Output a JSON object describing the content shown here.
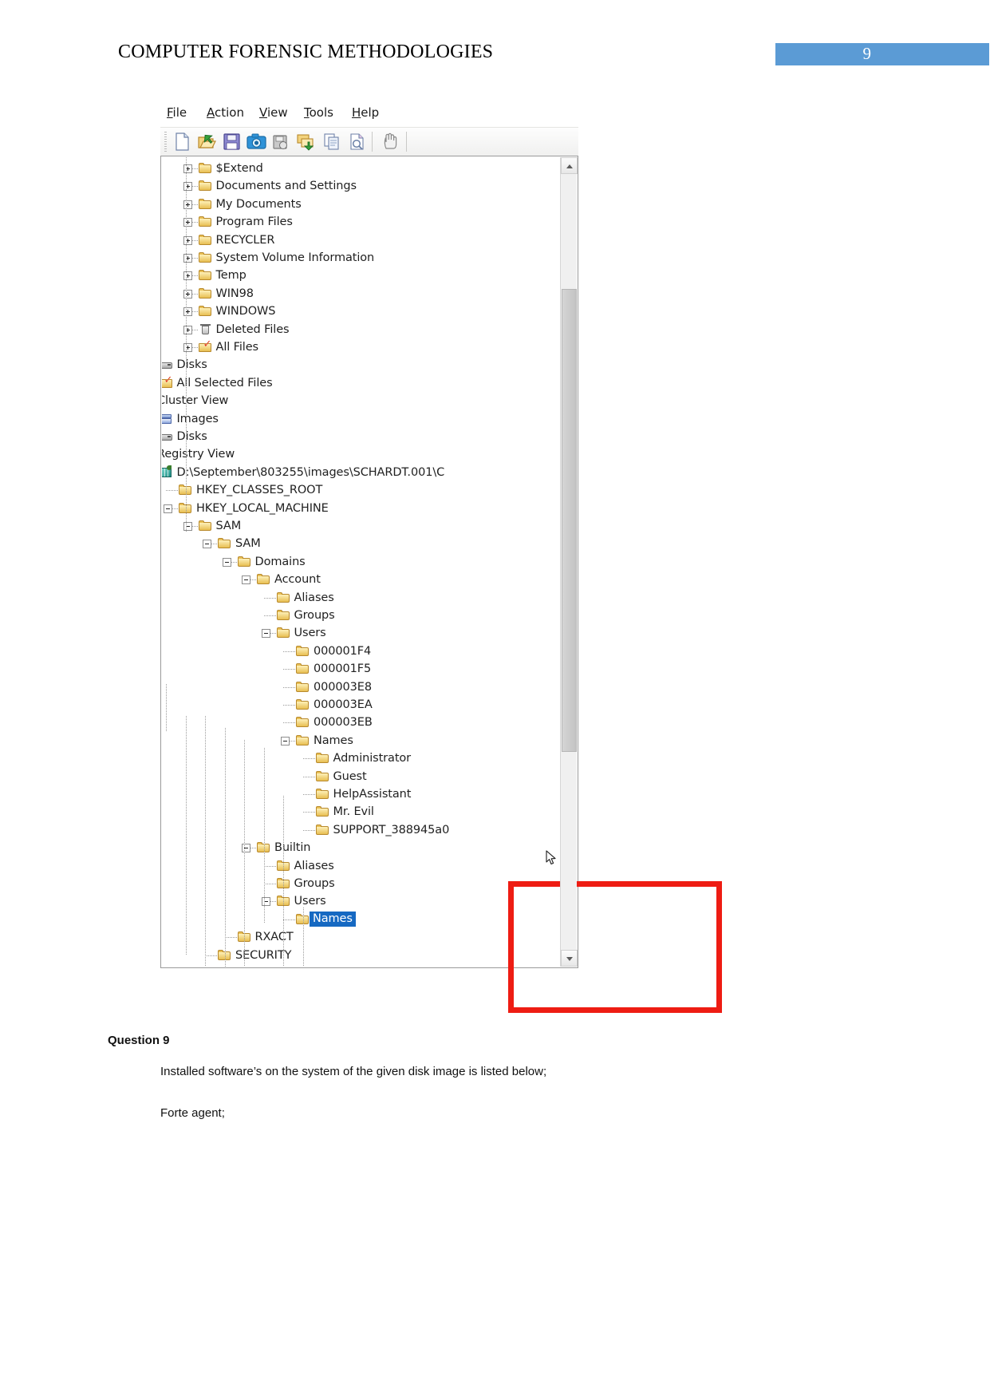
{
  "document": {
    "header_title": "COMPUTER FORENSIC METHODOLOGIES",
    "page_number": "9",
    "accent_color": "#5b9bd5"
  },
  "app_window": {
    "menubar": [
      {
        "name": "file",
        "accel": "F",
        "rest": "ile"
      },
      {
        "name": "action",
        "accel": "A",
        "rest": "ction"
      },
      {
        "name": "view",
        "accel": "V",
        "rest": "iew"
      },
      {
        "name": "tools",
        "accel": "T",
        "rest": "ools"
      },
      {
        "name": "help",
        "accel": "H",
        "rest": "elp"
      }
    ],
    "toolbar": [
      {
        "icon": "new-case-icon",
        "tip": "New"
      },
      {
        "icon": "open-case-icon",
        "tip": "Open"
      },
      {
        "icon": "save-icon",
        "tip": "Save"
      },
      {
        "icon": "snapshot-camera-icon",
        "tip": "Snapshot"
      },
      {
        "icon": "add-evidence-icon",
        "tip": "Add Evidence"
      },
      {
        "icon": "add-image-icon",
        "tip": "Add Image"
      },
      {
        "icon": "copy-icon",
        "tip": "Copy"
      },
      {
        "icon": "search-document-icon",
        "tip": "Search"
      },
      {
        "icon": "hand-pan-icon",
        "tip": "Pan"
      }
    ]
  },
  "tree": {
    "selected_label": "Names",
    "highlight_color": "#ee1c13",
    "selection_color": "#1669c2",
    "items": [
      {
        "label": "$Extend",
        "depth": 5,
        "icon": "folder-icon",
        "toggle": "plus"
      },
      {
        "label": "Documents and Settings",
        "depth": 5,
        "icon": "folder-icon",
        "toggle": "plus"
      },
      {
        "label": "My Documents",
        "depth": 5,
        "icon": "folder-icon",
        "toggle": "plus"
      },
      {
        "label": "Program Files",
        "depth": 5,
        "icon": "folder-icon",
        "toggle": "plus"
      },
      {
        "label": "RECYCLER",
        "depth": 5,
        "icon": "folder-icon",
        "toggle": "plus"
      },
      {
        "label": "System Volume Information",
        "depth": 5,
        "icon": "folder-icon",
        "toggle": "plus"
      },
      {
        "label": "Temp",
        "depth": 5,
        "icon": "folder-icon",
        "toggle": "plus"
      },
      {
        "label": "WIN98",
        "depth": 5,
        "icon": "folder-icon",
        "toggle": "plus"
      },
      {
        "label": "WINDOWS",
        "depth": 5,
        "icon": "folder-icon",
        "toggle": "plus"
      },
      {
        "label": "Deleted Files",
        "depth": 5,
        "icon": "trash-icon",
        "toggle": "plus"
      },
      {
        "label": "All Files",
        "depth": 5,
        "icon": "folder-checked-icon",
        "toggle": "plus"
      },
      {
        "label": "Disks",
        "depth": 3,
        "icon": "disk-icon",
        "toggle": "none"
      },
      {
        "label": "All Selected Files",
        "depth": 3,
        "icon": "folder-checked-icon",
        "toggle": "none"
      },
      {
        "label": "Cluster View",
        "depth": 2,
        "icon": "folder-icon",
        "toggle": "minus"
      },
      {
        "label": "Images",
        "depth": 3,
        "icon": "images-icon",
        "toggle": "plus"
      },
      {
        "label": "Disks",
        "depth": 3,
        "icon": "disk-icon",
        "toggle": "none"
      },
      {
        "label": "Registry View",
        "depth": 2,
        "icon": "registry-icon",
        "toggle": "minus"
      },
      {
        "label": "D:\\September\\803255\\images\\SCHARDT.001\\C",
        "depth": 3,
        "icon": "registry-icon",
        "toggle": "minus"
      },
      {
        "label": "HKEY_CLASSES_ROOT",
        "depth": 4,
        "icon": "folder-icon",
        "toggle": "none"
      },
      {
        "label": "HKEY_LOCAL_MACHINE",
        "depth": 4,
        "icon": "folder-icon",
        "toggle": "minus"
      },
      {
        "label": "SAM",
        "depth": 5,
        "icon": "folder-icon",
        "toggle": "minus"
      },
      {
        "label": "SAM",
        "depth": 6,
        "icon": "folder-icon",
        "toggle": "minus"
      },
      {
        "label": "Domains",
        "depth": 7,
        "icon": "folder-icon",
        "toggle": "minus"
      },
      {
        "label": "Account",
        "depth": 8,
        "icon": "folder-icon",
        "toggle": "minus"
      },
      {
        "label": "Aliases",
        "depth": 9,
        "icon": "folder-icon",
        "toggle": "none"
      },
      {
        "label": "Groups",
        "depth": 9,
        "icon": "folder-icon",
        "toggle": "none"
      },
      {
        "label": "Users",
        "depth": 9,
        "icon": "folder-icon",
        "toggle": "minus"
      },
      {
        "label": "000001F4",
        "depth": 10,
        "icon": "folder-icon",
        "toggle": "none"
      },
      {
        "label": "000001F5",
        "depth": 10,
        "icon": "folder-icon",
        "toggle": "none"
      },
      {
        "label": "000003E8",
        "depth": 10,
        "icon": "folder-icon",
        "toggle": "none"
      },
      {
        "label": "000003EA",
        "depth": 10,
        "icon": "folder-icon",
        "toggle": "none"
      },
      {
        "label": "000003EB",
        "depth": 10,
        "icon": "folder-icon",
        "toggle": "none"
      },
      {
        "label": "Names",
        "depth": 10,
        "icon": "folder-icon",
        "toggle": "minus"
      },
      {
        "label": "Administrator",
        "depth": 11,
        "icon": "folder-icon",
        "toggle": "none"
      },
      {
        "label": "Guest",
        "depth": 11,
        "icon": "folder-icon",
        "toggle": "none"
      },
      {
        "label": "HelpAssistant",
        "depth": 11,
        "icon": "folder-icon",
        "toggle": "none"
      },
      {
        "label": "Mr. Evil",
        "depth": 11,
        "icon": "folder-icon",
        "toggle": "none"
      },
      {
        "label": "SUPPORT_388945a0",
        "depth": 11,
        "icon": "folder-icon",
        "toggle": "none"
      },
      {
        "label": "Builtin",
        "depth": 8,
        "icon": "folder-icon",
        "toggle": "minus"
      },
      {
        "label": "Aliases",
        "depth": 9,
        "icon": "folder-icon",
        "toggle": "none"
      },
      {
        "label": "Groups",
        "depth": 9,
        "icon": "folder-icon",
        "toggle": "none"
      },
      {
        "label": "Users",
        "depth": 9,
        "icon": "folder-icon",
        "toggle": "minus"
      },
      {
        "label": "Names",
        "depth": 10,
        "icon": "folder-icon",
        "toggle": "none",
        "selected": true
      },
      {
        "label": "RXACT",
        "depth": 7,
        "icon": "folder-icon",
        "toggle": "none"
      },
      {
        "label": "SECURITY",
        "depth": 6,
        "icon": "folder-icon",
        "toggle": "none"
      }
    ]
  },
  "body_text": {
    "question_heading": "Question 9",
    "paragraph_1": "Installed software’s on the system of the given disk image is listed below;",
    "paragraph_2": "Forte agent;"
  }
}
